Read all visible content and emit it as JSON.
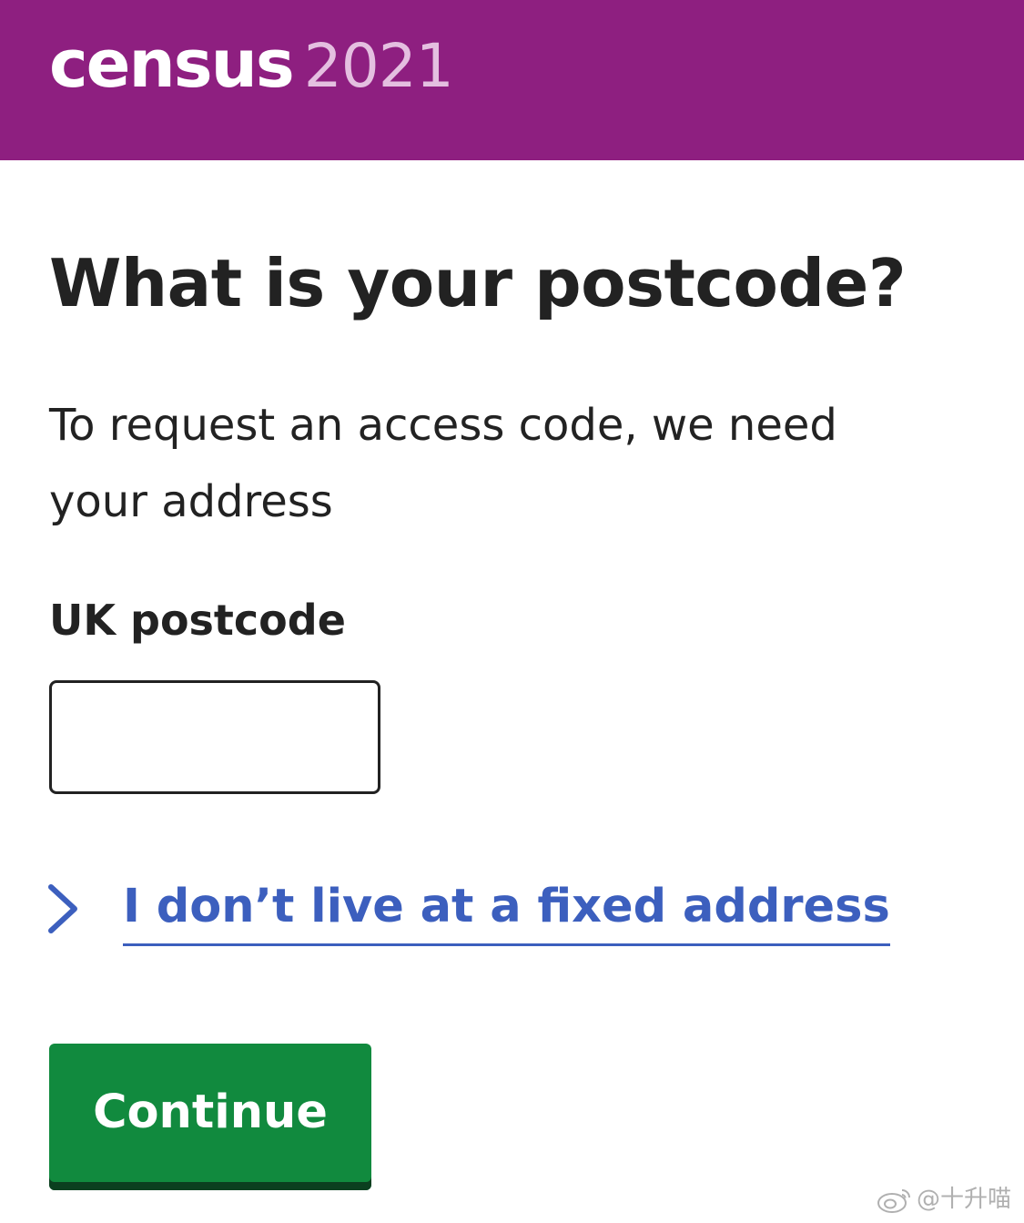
{
  "header": {
    "logo_word": "census",
    "logo_year": "2021",
    "brand_color": "#8e1f80"
  },
  "page": {
    "title": "What is your postcode?",
    "description": "To request an access code, we need your address"
  },
  "postcode_field": {
    "label": "UK postcode",
    "value": "",
    "placeholder": ""
  },
  "fixed_address_link": {
    "label": "I don’t live at a fixed address",
    "icon": "chevron-right-icon",
    "color": "#3c5fbe"
  },
  "continue_button": {
    "label": "Continue",
    "color": "#118a3e"
  },
  "watermark": {
    "icon": "weibo-icon",
    "text": "@十升喵"
  }
}
